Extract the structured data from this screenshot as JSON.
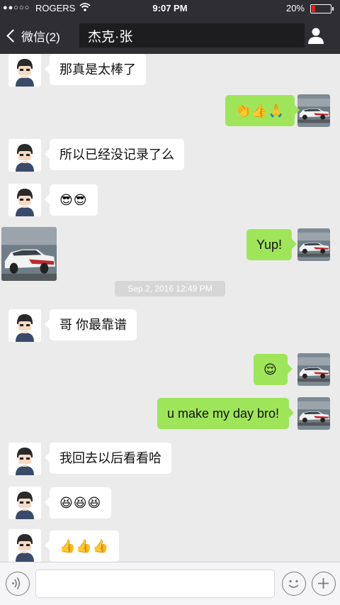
{
  "status_bar": {
    "signal": "●●○○○",
    "carrier": "ROGERS",
    "time": "9:07 PM",
    "battery_text": "20%",
    "battery_level": 0.2
  },
  "nav_bar": {
    "back_label": "微信(2)",
    "chat_title": "杰克·张",
    "back_icon": "chevron-left-icon",
    "profile_icon": "person-icon"
  },
  "messages": [
    {
      "side": "in",
      "type": "text",
      "text": "那真是太棒了"
    },
    {
      "side": "out",
      "type": "emoji",
      "text": "👏👍🙏"
    },
    {
      "side": "in",
      "type": "text",
      "text": "所以已经没记录了么"
    },
    {
      "side": "in",
      "type": "emoji",
      "text": "😎😎"
    },
    {
      "side": "in",
      "type": "image",
      "text": ""
    },
    {
      "side": "out",
      "type": "text",
      "text": "Yup!"
    },
    {
      "side": "system",
      "type": "timestamp",
      "text": "Sep 2, 2016 12:49 PM"
    },
    {
      "side": "in",
      "type": "text",
      "text": "哥 你最靠谱"
    },
    {
      "side": "out",
      "type": "emoji",
      "text": "😌"
    },
    {
      "side": "out",
      "type": "text",
      "text": "u make my day bro!"
    },
    {
      "side": "in",
      "type": "text",
      "text": "我回去以后看看哈"
    },
    {
      "side": "in",
      "type": "emoji",
      "text": "😆😆😆"
    },
    {
      "side": "in",
      "type": "emoji",
      "text": "👍👍👍"
    }
  ],
  "input_bar": {
    "voice_icon": "voice-icon",
    "message_value": "",
    "emoji_icon": "smiley-icon",
    "plus_icon": "plus-icon"
  },
  "colors": {
    "nav_background": "#2e2e33",
    "chat_background": "#ebebeb",
    "outgoing_bubble": "#9fe55a",
    "incoming_bubble": "#ffffff",
    "battery_low": "#e02020"
  }
}
